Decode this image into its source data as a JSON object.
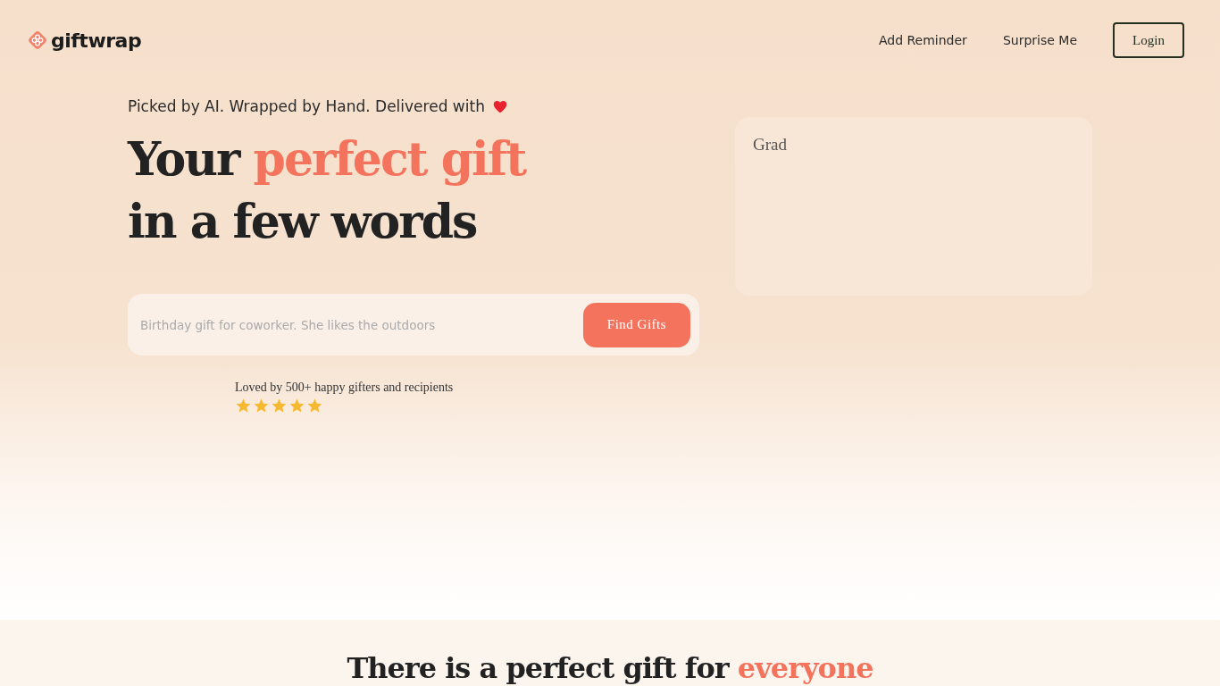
{
  "brand": {
    "name": "giftwrap"
  },
  "nav": {
    "links": [
      "Add Reminder",
      "Surprise Me"
    ],
    "login": "Login"
  },
  "hero": {
    "tagline": "Picked by AI. Wrapped by Hand. Delivered with",
    "headline": [
      [
        {
          "text": "Your ",
          "accent": false
        },
        {
          "text": "perfect gift",
          "accent": true
        }
      ],
      [
        {
          "text": "in a few words",
          "accent": false
        }
      ]
    ],
    "search": {
      "placeholder": "Birthday gift for coworker. She likes the outdoors",
      "button": "Find Gifts"
    },
    "rating": {
      "text": "Loved by 500+ happy gifters and recipients",
      "stars": 5
    },
    "card": {
      "text": "Grad"
    }
  },
  "section": {
    "heading": [
      {
        "text": "There is a perfect gift for ",
        "accent": false
      },
      {
        "text": "everyone",
        "accent": true
      }
    ]
  }
}
